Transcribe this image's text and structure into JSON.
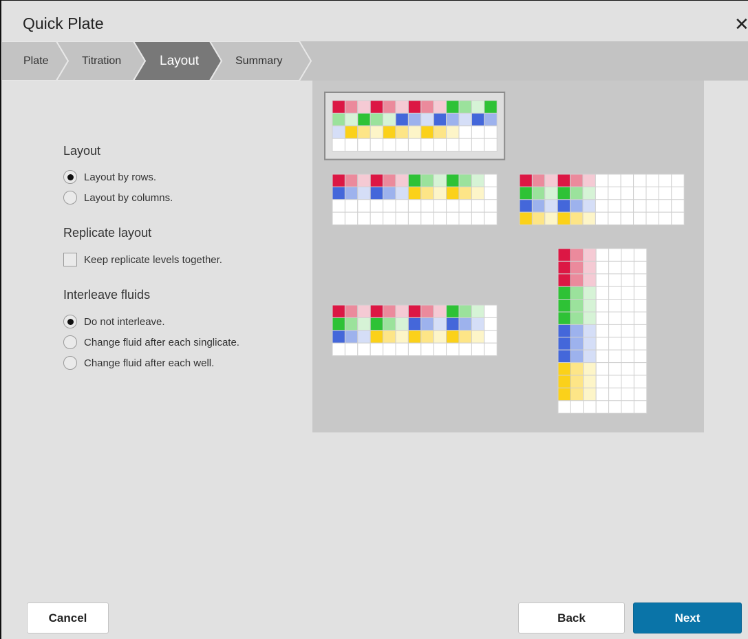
{
  "dialog": {
    "title": "Quick Plate"
  },
  "wizard": {
    "steps": [
      "Plate",
      "Titration",
      "Layout",
      "Summary"
    ],
    "active": 2
  },
  "options": {
    "layout": {
      "heading": "Layout",
      "choices": [
        "Layout by rows.",
        "Layout by columns."
      ],
      "selected": 0
    },
    "replicate": {
      "heading": "Replicate layout",
      "checkbox_label": "Keep replicate levels together.",
      "checked": false
    },
    "interleave": {
      "heading": "Interleave fluids",
      "choices": [
        "Do not interleave.",
        "Change fluid after each singlicate.",
        "Change fluid after each well."
      ],
      "selected": 0
    }
  },
  "colors": {
    "red": [
      "#dc1744",
      "#eb8a9c",
      "#f5cad4"
    ],
    "green": [
      "#2ec236",
      "#9be29c",
      "#d6f3d6"
    ],
    "blue": [
      "#4467da",
      "#9db2ed",
      "#d5def7"
    ],
    "yellow": [
      "#fbd11a",
      "#fde587",
      "#fdf5c8"
    ],
    "empty": "#ffffff",
    "accent": "#0a74a8"
  },
  "previews": [
    {
      "selected": true,
      "rows": [
        [
          "R0",
          "R1",
          "R2",
          "R0",
          "R1",
          "R2",
          "R0",
          "R1",
          "R2",
          "G0",
          "G1",
          "G2",
          "G0"
        ],
        [
          "G1",
          "G2",
          "G0",
          "G1",
          "G2",
          "B0",
          "B1",
          "B2",
          "B0",
          "B1",
          "B2",
          "B0",
          "B1"
        ],
        [
          "B2",
          "Y0",
          "Y1",
          "Y2",
          "Y0",
          "Y1",
          "Y2",
          "Y0",
          "Y1",
          "Y2",
          "E",
          "E",
          "E"
        ],
        [
          "E",
          "E",
          "E",
          "E",
          "E",
          "E",
          "E",
          "E",
          "E",
          "E",
          "E",
          "E",
          "E"
        ]
      ]
    },
    {
      "selected": false,
      "rows": [
        [
          "R0",
          "R1",
          "R2",
          "R0",
          "R1",
          "R2",
          "G0",
          "G1",
          "G2",
          "G0",
          "G1",
          "G2",
          "E"
        ],
        [
          "B0",
          "B1",
          "B2",
          "B0",
          "B1",
          "B2",
          "Y0",
          "Y1",
          "Y2",
          "Y0",
          "Y1",
          "Y2",
          "E"
        ],
        [
          "E",
          "E",
          "E",
          "E",
          "E",
          "E",
          "E",
          "E",
          "E",
          "E",
          "E",
          "E",
          "E"
        ],
        [
          "E",
          "E",
          "E",
          "E",
          "E",
          "E",
          "E",
          "E",
          "E",
          "E",
          "E",
          "E",
          "E"
        ]
      ]
    },
    {
      "selected": false,
      "rows": [
        [
          "R0",
          "R1",
          "R2",
          "R0",
          "R1",
          "R2",
          "E",
          "E",
          "E",
          "E",
          "E",
          "E",
          "E"
        ],
        [
          "G0",
          "G1",
          "G2",
          "G0",
          "G1",
          "G2",
          "E",
          "E",
          "E",
          "E",
          "E",
          "E",
          "E"
        ],
        [
          "B0",
          "B1",
          "B2",
          "B0",
          "B1",
          "B2",
          "E",
          "E",
          "E",
          "E",
          "E",
          "E",
          "E"
        ],
        [
          "Y0",
          "Y1",
          "Y2",
          "Y0",
          "Y1",
          "Y2",
          "E",
          "E",
          "E",
          "E",
          "E",
          "E",
          "E"
        ]
      ]
    },
    {
      "selected": false,
      "rows": [
        [
          "R0",
          "R1",
          "R2",
          "R0",
          "R1",
          "R2",
          "R0",
          "R1",
          "R2",
          "G0",
          "G1",
          "G2",
          "E"
        ],
        [
          "G0",
          "G1",
          "G2",
          "G0",
          "G1",
          "G2",
          "B0",
          "B1",
          "B2",
          "B0",
          "B1",
          "B2",
          "E"
        ],
        [
          "B0",
          "B1",
          "B2",
          "Y0",
          "Y1",
          "Y2",
          "Y0",
          "Y1",
          "Y2",
          "Y0",
          "Y1",
          "Y2",
          "E"
        ],
        [
          "E",
          "E",
          "E",
          "E",
          "E",
          "E",
          "E",
          "E",
          "E",
          "E",
          "E",
          "E",
          "E"
        ]
      ]
    },
    {
      "selected": false,
      "rows": [
        [
          "R0",
          "R1",
          "R2",
          "E",
          "E",
          "E",
          "E"
        ],
        [
          "R0",
          "R1",
          "R2",
          "E",
          "E",
          "E",
          "E"
        ],
        [
          "R0",
          "R1",
          "R2",
          "E",
          "E",
          "E",
          "E"
        ],
        [
          "G0",
          "G1",
          "G2",
          "E",
          "E",
          "E",
          "E"
        ],
        [
          "G0",
          "G1",
          "G2",
          "E",
          "E",
          "E",
          "E"
        ],
        [
          "G0",
          "G1",
          "G2",
          "E",
          "E",
          "E",
          "E"
        ],
        [
          "B0",
          "B1",
          "B2",
          "E",
          "E",
          "E",
          "E"
        ],
        [
          "B0",
          "B1",
          "B2",
          "E",
          "E",
          "E",
          "E"
        ],
        [
          "B0",
          "B1",
          "B2",
          "E",
          "E",
          "E",
          "E"
        ],
        [
          "Y0",
          "Y1",
          "Y2",
          "E",
          "E",
          "E",
          "E"
        ],
        [
          "Y0",
          "Y1",
          "Y2",
          "E",
          "E",
          "E",
          "E"
        ],
        [
          "Y0",
          "Y1",
          "Y2",
          "E",
          "E",
          "E",
          "E"
        ],
        [
          "E",
          "E",
          "E",
          "E",
          "E",
          "E",
          "E"
        ]
      ]
    }
  ],
  "buttons": {
    "cancel": "Cancel",
    "back": "Back",
    "next": "Next"
  }
}
